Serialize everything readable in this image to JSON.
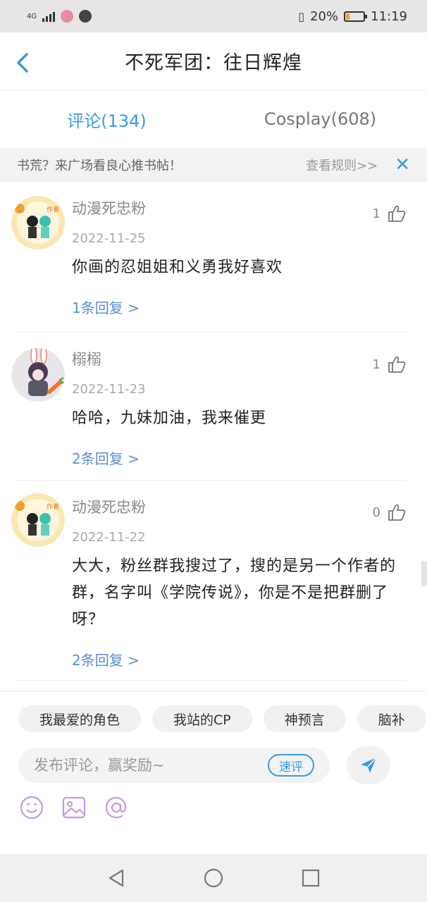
{
  "status_bar": {
    "network": "4G",
    "battery_percent": "20%",
    "time": "11:19"
  },
  "header": {
    "title": "不死军团：往日辉煌"
  },
  "tabs": [
    {
      "label": "评论(134)",
      "active": true
    },
    {
      "label": "Cosplay(608)",
      "active": false
    }
  ],
  "notice": {
    "message": "书荒？来广场看良心推书帖！",
    "rules_link": "查看规则>>",
    "close_icon": "close-icon"
  },
  "comments": [
    {
      "user": "动漫死忠粉",
      "date": "2022-11-25",
      "likes": "1",
      "text": "你画的忍姐姐和义勇我好喜欢",
      "replies": "1条回复 >"
    },
    {
      "user": "榒榒",
      "date": "2022-11-23",
      "likes": "1",
      "text": "哈哈，九妹加油，我来催更",
      "replies": "2条回复 >"
    },
    {
      "user": "动漫死忠粉",
      "date": "2022-11-22",
      "likes": "0",
      "text": "大大，粉丝群我搜过了，搜的是另一个作者的群，名字叫《学院传说》，你是不是把群删了呀？",
      "replies": "2条回复 >"
    }
  ],
  "composer": {
    "chips": [
      "我最爱的角色",
      "我站的CP",
      "神预言",
      "脑补"
    ],
    "placeholder": "发布评论，赢奖励~",
    "quick_button": "速评"
  },
  "colors": {
    "accent": "#3b9ae0",
    "reply_link": "#5a8fd0"
  }
}
